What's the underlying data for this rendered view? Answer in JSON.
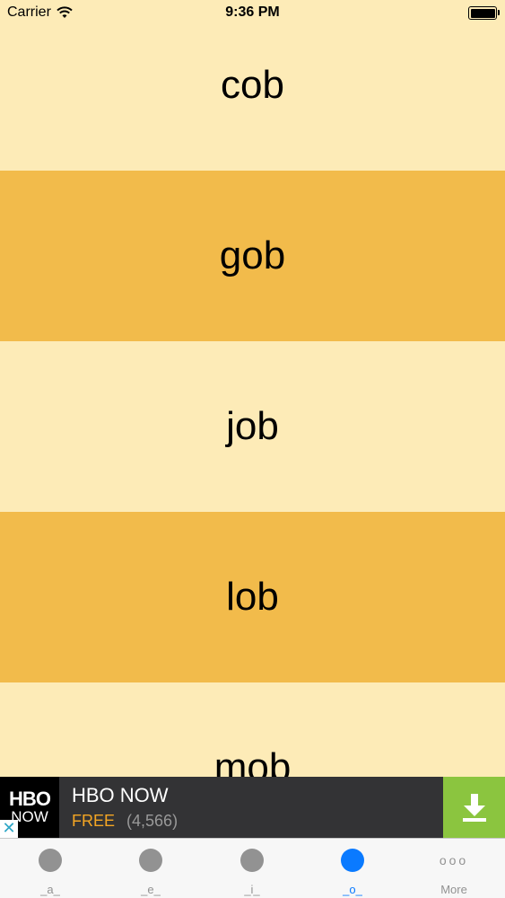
{
  "status_bar": {
    "carrier": "Carrier",
    "time": "9:36 PM",
    "battery_level": 1.0
  },
  "word_list": {
    "words": [
      "cob",
      "gob",
      "job",
      "lob",
      "mob"
    ]
  },
  "ad": {
    "logo_top": "HBO",
    "logo_bottom": "NOW",
    "title": "HBO NOW",
    "price": "FREE",
    "rating_count": "(4,566)",
    "close_glyph": "✕",
    "download_icon": "download-arrow-icon"
  },
  "tab_bar": {
    "tabs": [
      {
        "label": "_a_"
      },
      {
        "label": "_e_"
      },
      {
        "label": "_i_"
      },
      {
        "label": "_o_"
      },
      {
        "label": "More"
      }
    ],
    "selected": "_o_",
    "more_glyph": "ooo"
  },
  "colors": {
    "row_light": "#fdebb7",
    "row_dark": "#f2bb4b",
    "tab_active": "#0a7aff",
    "tab_inactive": "#929292",
    "ad_price": "#f5a623",
    "ad_download_bg": "#8bc53f"
  }
}
